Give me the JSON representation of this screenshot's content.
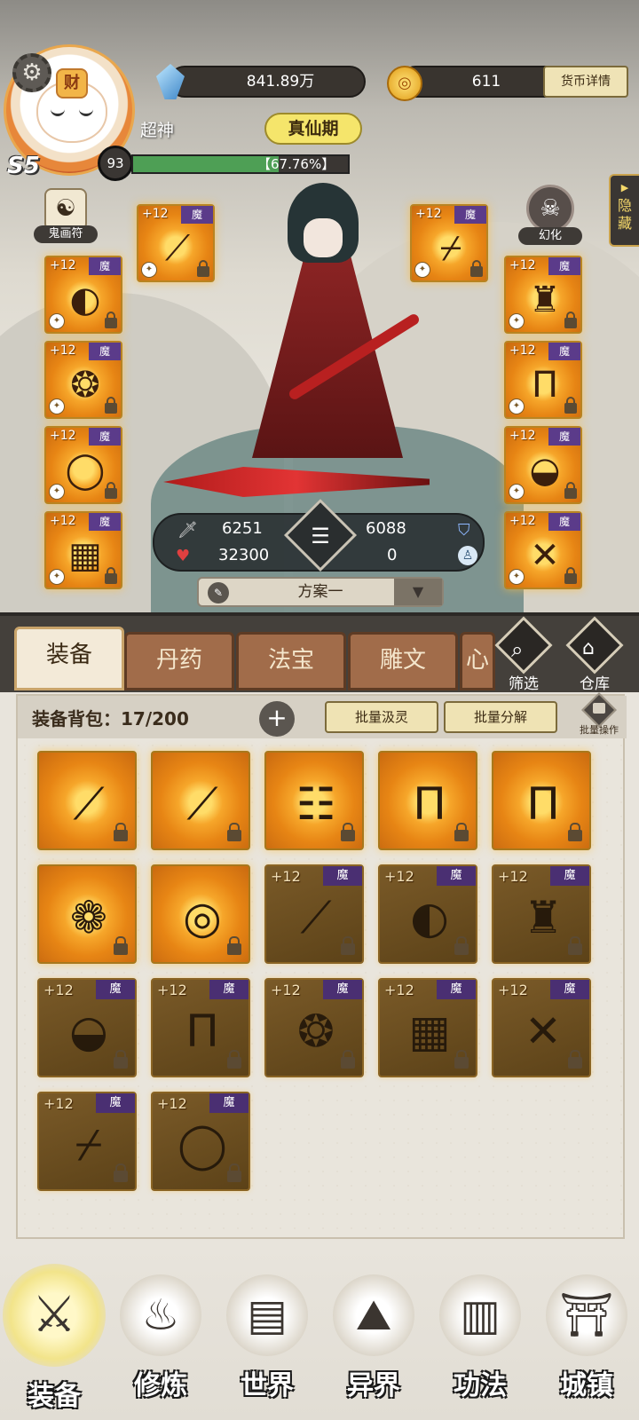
{
  "player": {
    "name": "超神",
    "realm": "真仙期",
    "vip": "S5",
    "level": "93",
    "exp_percent_text": "【67.76%】",
    "exp_fraction": 0.6776,
    "avatar_tag": "财"
  },
  "currency": {
    "spirit_stones": "841.89万",
    "gold": "611",
    "details_button": "货币详情"
  },
  "side_buttons": {
    "talisman": "鬼画符",
    "transform": "幻化",
    "hide": "隐藏"
  },
  "equipment_slots": [
    {
      "plus": "+12",
      "tag": "魔",
      "icon": "spear-icon"
    },
    {
      "plus": "+12",
      "tag": "魔",
      "icon": "dagger-icon"
    },
    {
      "plus": "+12",
      "tag": "魔",
      "icon": "mask-icon"
    },
    {
      "plus": "+12",
      "tag": "魔",
      "icon": "robe-icon"
    },
    {
      "plus": "+12",
      "tag": "魔",
      "icon": "necklace-icon"
    },
    {
      "plus": "+12",
      "tag": "魔",
      "icon": "pants-icon"
    },
    {
      "plus": "+12",
      "tag": "魔",
      "icon": "ring-icon"
    },
    {
      "plus": "+12",
      "tag": "魔",
      "icon": "shoes-icon"
    },
    {
      "plus": "+12",
      "tag": "魔",
      "icon": "talisman-pendant-icon"
    },
    {
      "plus": "+12",
      "tag": "魔",
      "icon": "crossed-swords-icon"
    }
  ],
  "stats": {
    "attack": "6251",
    "defense": "6088",
    "hp": "32300",
    "speed": "0"
  },
  "plan": {
    "label": "方案一"
  },
  "tabs": [
    {
      "label": "装备",
      "active": true
    },
    {
      "label": "丹药"
    },
    {
      "label": "法宝"
    },
    {
      "label": "雕文"
    },
    {
      "label": "心"
    }
  ],
  "tab_actions": {
    "filter": "筛选",
    "storage": "仓库"
  },
  "bag": {
    "title": "装备背包：17/200",
    "batch_absorb": "批量汲灵",
    "batch_decompose": "批量分解",
    "batch_operation": "批量操作",
    "items": [
      {
        "plus": "",
        "tag": "",
        "icon": "sword-icon",
        "dim": false
      },
      {
        "plus": "",
        "tag": "",
        "icon": "spear-icon",
        "dim": false
      },
      {
        "plus": "",
        "tag": "",
        "icon": "bagua-hat-icon",
        "dim": false
      },
      {
        "plus": "",
        "tag": "",
        "icon": "blue-pants-icon",
        "dim": false
      },
      {
        "plus": "",
        "tag": "",
        "icon": "cream-pants-icon",
        "dim": false
      },
      {
        "plus": "",
        "tag": "",
        "icon": "jade-ring-icon",
        "dim": false
      },
      {
        "plus": "",
        "tag": "",
        "icon": "pendant-icon",
        "dim": false
      },
      {
        "plus": "+12",
        "tag": "魔",
        "icon": "spear-icon",
        "dim": true
      },
      {
        "plus": "+12",
        "tag": "魔",
        "icon": "mask-icon",
        "dim": true
      },
      {
        "plus": "+12",
        "tag": "魔",
        "icon": "robe-icon",
        "dim": true
      },
      {
        "plus": "+12",
        "tag": "魔",
        "icon": "shoes-icon",
        "dim": true
      },
      {
        "plus": "+12",
        "tag": "魔",
        "icon": "pants-icon",
        "dim": true
      },
      {
        "plus": "+12",
        "tag": "魔",
        "icon": "necklace-icon",
        "dim": true
      },
      {
        "plus": "+12",
        "tag": "魔",
        "icon": "talisman-pendant-icon",
        "dim": true
      },
      {
        "plus": "+12",
        "tag": "魔",
        "icon": "crossed-swords-icon",
        "dim": true
      },
      {
        "plus": "+12",
        "tag": "魔",
        "icon": "dagger-icon",
        "dim": true
      },
      {
        "plus": "+12",
        "tag": "魔",
        "icon": "ring-icon",
        "dim": true
      }
    ]
  },
  "bottom_nav": [
    {
      "label": "装备",
      "icon": "armor-icon",
      "active": true
    },
    {
      "label": "修炼",
      "icon": "cultivator-icon"
    },
    {
      "label": "世界",
      "icon": "map-scroll-icon"
    },
    {
      "label": "异界",
      "icon": "mountain-icon"
    },
    {
      "label": "功法",
      "icon": "books-icon"
    },
    {
      "label": "城镇",
      "icon": "pavilion-icon"
    }
  ],
  "colors": {
    "slot_gold": "#f6a62a",
    "mo_tag": "#5b3b8a",
    "exp_green": "#4e9f55",
    "tab_brown": "#a16c4a"
  }
}
